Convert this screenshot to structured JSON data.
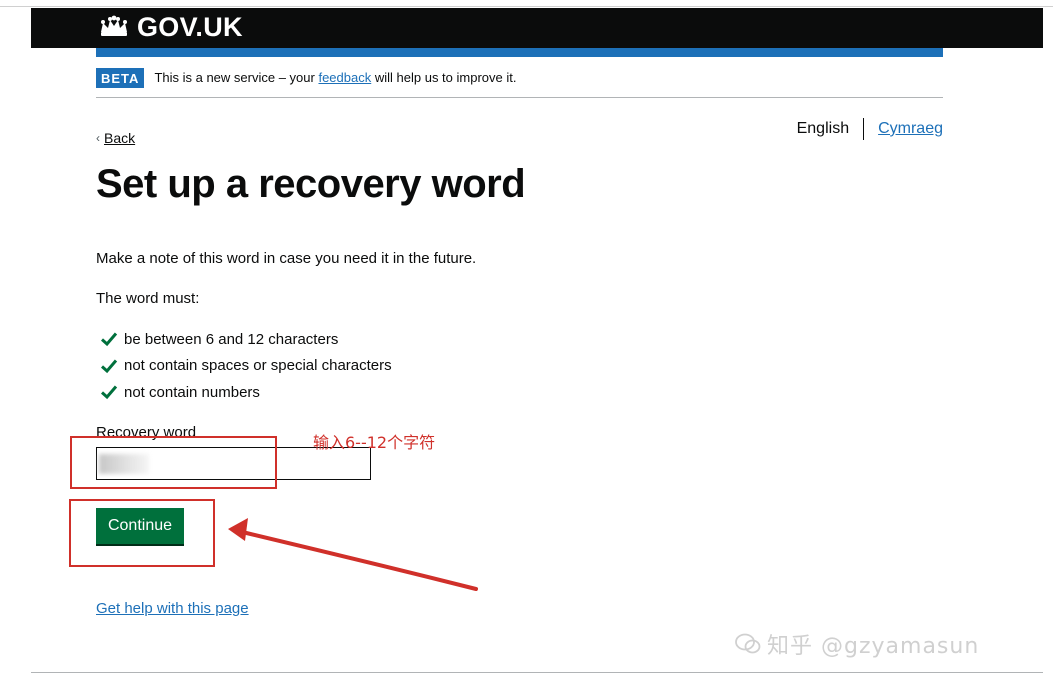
{
  "header": {
    "logo_text": "GOV.UK",
    "brand_color": "#1d70b8"
  },
  "phase_banner": {
    "tag": "BETA",
    "text_before": "This is a new service – your",
    "link": "feedback",
    "text_after": "will help us to improve it."
  },
  "nav": {
    "back_label": "Back"
  },
  "language": {
    "current": "English",
    "alternate": "Cymraeg"
  },
  "main": {
    "title": "Set up a recovery word",
    "lead": "Make a note of this word in case you need it in the future.",
    "must_label": "The word must:",
    "rules": [
      "be between 6 and 12 characters",
      "not contain spaces or special characters",
      "not contain numbers"
    ],
    "field_label": "Recovery word",
    "field_value": "",
    "continue_label": "Continue",
    "help_link": "Get help with this page"
  },
  "annotation": {
    "note": "输入6--12个字符",
    "color": "#d0302a"
  },
  "watermark": {
    "text": "知乎 @gzyamasun"
  },
  "colors": {
    "button_green": "#00703c",
    "link_blue": "#1d70b8",
    "tick_green": "#00703c"
  }
}
